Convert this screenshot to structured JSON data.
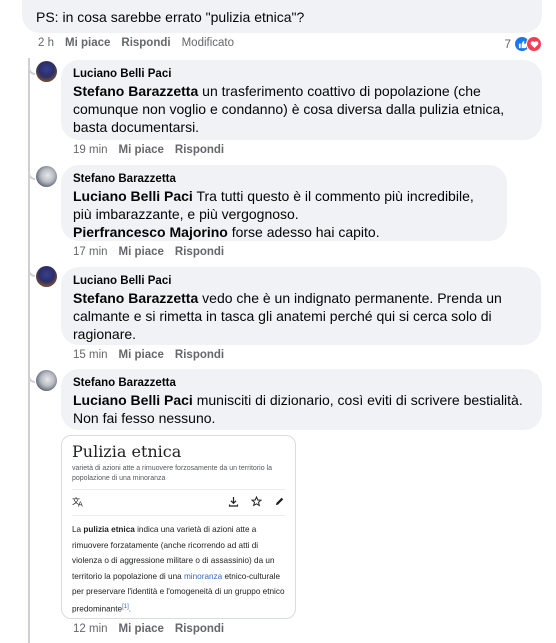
{
  "top_comment": {
    "text": "PS: in cosa sarebbe errato \"pulizia etnica\"?",
    "time": "2 h",
    "like": "Mi piace",
    "reply": "Rispondi",
    "edited": "Modificato",
    "reaction_count": "7"
  },
  "replies": [
    {
      "author": "Luciano Belli Paci",
      "mention": "Stefano Barazzetta",
      "text": " un trasferimento coattivo di popolazione (che comunque non voglio e condanno) è cosa diversa dalla pulizia etnica, basta documentarsi.",
      "time": "19 min",
      "like": "Mi piace",
      "reply": "Rispondi"
    },
    {
      "author": "Stefano Barazzetta",
      "mention": "Luciano Belli Paci",
      "text": " Tra tutti questo è il commento più incredibile, più imbarazzante, e più vergognoso.",
      "mention2": "Pierfrancesco Majorino",
      "text2": " forse adesso hai capito.",
      "time": "17 min",
      "like": "Mi piace",
      "reply": "Rispondi"
    },
    {
      "author": "Luciano Belli Paci",
      "mention": "Stefano Barazzetta",
      "text": " vedo che è un indignato permanente. Prenda un calmante e si rimetta in tasca gli anatemi perché qui si cerca solo di ragionare.",
      "time": "15 min",
      "like": "Mi piace",
      "reply": "Rispondi"
    },
    {
      "author": "Stefano Barazzetta",
      "mention": "Luciano Belli Paci",
      "text": " munisciti di dizionario, così eviti di scrivere bestialità. Non fai fesso nessuno.",
      "time": "12 min",
      "like": "Mi piace",
      "reply": "Rispondi"
    }
  ],
  "wiki": {
    "title": "Pulizia etnica",
    "subtitle": "varietà di azioni atte a rimuovere forzosamente da un territorio la popolazione di una minoranza",
    "body_pre": "La ",
    "body_bold": "pulizia etnica",
    "body_mid": " indica una varietà di azioni atte a rimuovere forzatamente (anche ricorrendo ad atti di violenza o di aggressione militare o di assassinio) da un territorio la popolazione di una ",
    "body_link": "minoranza",
    "body_post": " etnico-culturale per preservare l'identità e l'omogeneità di un gruppo etnico predominante",
    "ref": "[1]",
    "body_end": "."
  },
  "colors": {
    "bubble": "#f0f2f5",
    "meta": "#65676b",
    "like_blue": "#1877f2",
    "love_red": "#f33e58",
    "link": "#3366cc"
  },
  "icons": [
    "translate-icon",
    "download-icon",
    "star-icon",
    "edit-icon",
    "like-reaction-icon",
    "love-reaction-icon"
  ]
}
